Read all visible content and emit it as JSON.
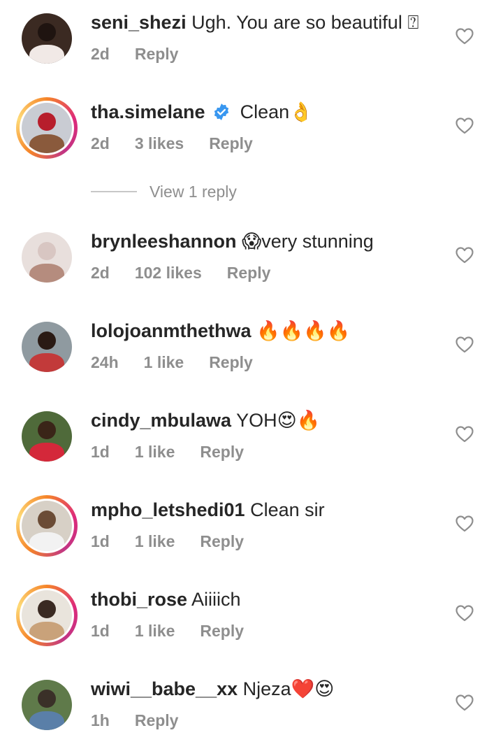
{
  "view_replies_label": "View 1 reply",
  "comments": [
    {
      "username": "seni_shezi",
      "text": "Ugh. You are so beautiful ⍰",
      "time": "2d",
      "likes": "",
      "reply": "Reply",
      "story_ring": false,
      "verified": false,
      "avatar": [
        "#3b2a22",
        "#1f1410",
        "#f1e9e6"
      ]
    },
    {
      "username": "tha.simelane",
      "text": "Clean👌",
      "time": "2d",
      "likes": "3 likes",
      "reply": "Reply",
      "story_ring": true,
      "verified": true,
      "avatar": [
        "#c9ccd3",
        "#b71e2c",
        "#8a5a3c"
      ]
    },
    {
      "username": "brynleeshannon",
      "text": "😱very stunning",
      "time": "2d",
      "likes": "102 likes",
      "reply": "Reply",
      "story_ring": false,
      "verified": false,
      "avatar": [
        "#e8dfdc",
        "#d8c6c2",
        "#b58c7e"
      ]
    },
    {
      "username": "lolojoanmthethwa",
      "text": "🔥🔥🔥🔥",
      "time": "24h",
      "likes": "1 like",
      "reply": "Reply",
      "story_ring": false,
      "verified": false,
      "avatar": [
        "#8f9aa0",
        "#2a1a14",
        "#c23a3a"
      ]
    },
    {
      "username": "cindy_mbulawa",
      "text": "YOH😍🔥",
      "time": "1d",
      "likes": "1 like",
      "reply": "Reply",
      "story_ring": false,
      "verified": false,
      "avatar": [
        "#4f6a3a",
        "#3a2518",
        "#d4283a"
      ]
    },
    {
      "username": "mpho_letshedi01",
      "text": "Clean sir",
      "time": "1d",
      "likes": "1 like",
      "reply": "Reply",
      "story_ring": true,
      "verified": false,
      "avatar": [
        "#d7d0c6",
        "#6b4c36",
        "#f2f2f2"
      ]
    },
    {
      "username": "thobi_rose",
      "text": "Aiiiich",
      "time": "1d",
      "likes": "1 like",
      "reply": "Reply",
      "story_ring": true,
      "verified": false,
      "avatar": [
        "#e9e4dc",
        "#3a2a22",
        "#c9a27a"
      ]
    },
    {
      "username": "wiwi__babe__xx",
      "text": "Njeza❤️😍",
      "time": "1h",
      "likes": "",
      "reply": "Reply",
      "story_ring": false,
      "verified": false,
      "avatar": [
        "#5f7a4a",
        "#3a3028",
        "#5a7fa8"
      ]
    }
  ]
}
